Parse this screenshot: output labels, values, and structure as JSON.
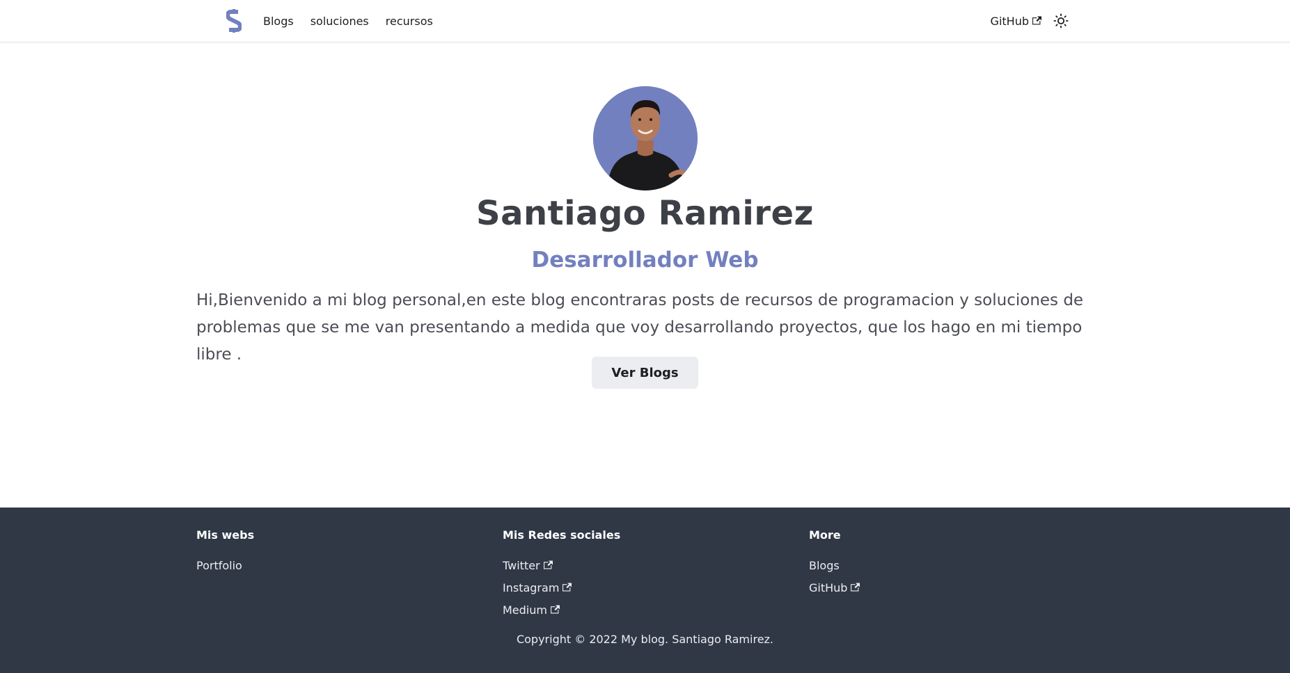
{
  "navbar": {
    "logo_icon": "s-logo-icon",
    "links": [
      "Blogs",
      "soluciones",
      "recursos"
    ],
    "github_label": "GitHub",
    "theme_icon": "sun-icon"
  },
  "hero": {
    "name": "Santiago Ramirez",
    "role": "Desarrollador Web",
    "description": "Hi,Bienvenido a mi blog personal,en este blog encontraras posts de recursos de programacion y soluciones de problemas que se me van presentando a medida que voy desarrollando proyectos, que los hago en mi tiempo libre .",
    "cta_label": "Ver Blogs"
  },
  "footer": {
    "columns": [
      {
        "title": "Mis webs",
        "items": [
          {
            "label": "Portfolio",
            "external": false
          }
        ]
      },
      {
        "title": "Mis Redes sociales",
        "items": [
          {
            "label": "Twitter",
            "external": true
          },
          {
            "label": "Instagram",
            "external": true
          },
          {
            "label": "Medium",
            "external": true
          }
        ]
      },
      {
        "title": "More",
        "items": [
          {
            "label": "Blogs",
            "external": false
          },
          {
            "label": "GitHub",
            "external": true
          }
        ]
      }
    ],
    "copyright": "Copyright © 2022 My blog. Santiago Ramirez."
  },
  "colors": {
    "accent": "#7380bf",
    "footer_bg": "#303846",
    "heading": "#3e4047",
    "button_bg": "#ebedf0"
  }
}
